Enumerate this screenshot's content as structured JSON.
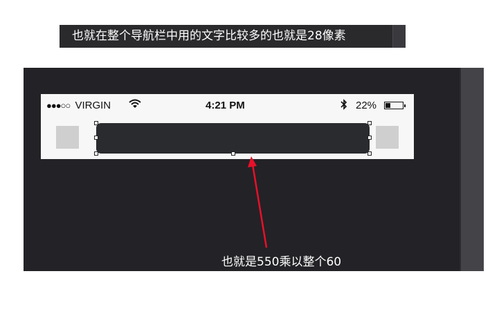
{
  "caption_top": "也就在整个导航栏中用的文字比较多的也就是28像素",
  "caption_bottom": "也就是550乘以整个60",
  "status_bar": {
    "signal": "●●●○○",
    "carrier": "VIRGIN",
    "wifi_icon": "wifi-icon",
    "time": "4:21 PM",
    "bluetooth_icon": "bluetooth-icon",
    "battery_percent": "22%",
    "battery_level": 0.22
  },
  "colors": {
    "workspace": "#232226",
    "nav_bar": "#2a2b2e",
    "placeholder": "#cfcfcf",
    "arrow": "#e8102a"
  }
}
